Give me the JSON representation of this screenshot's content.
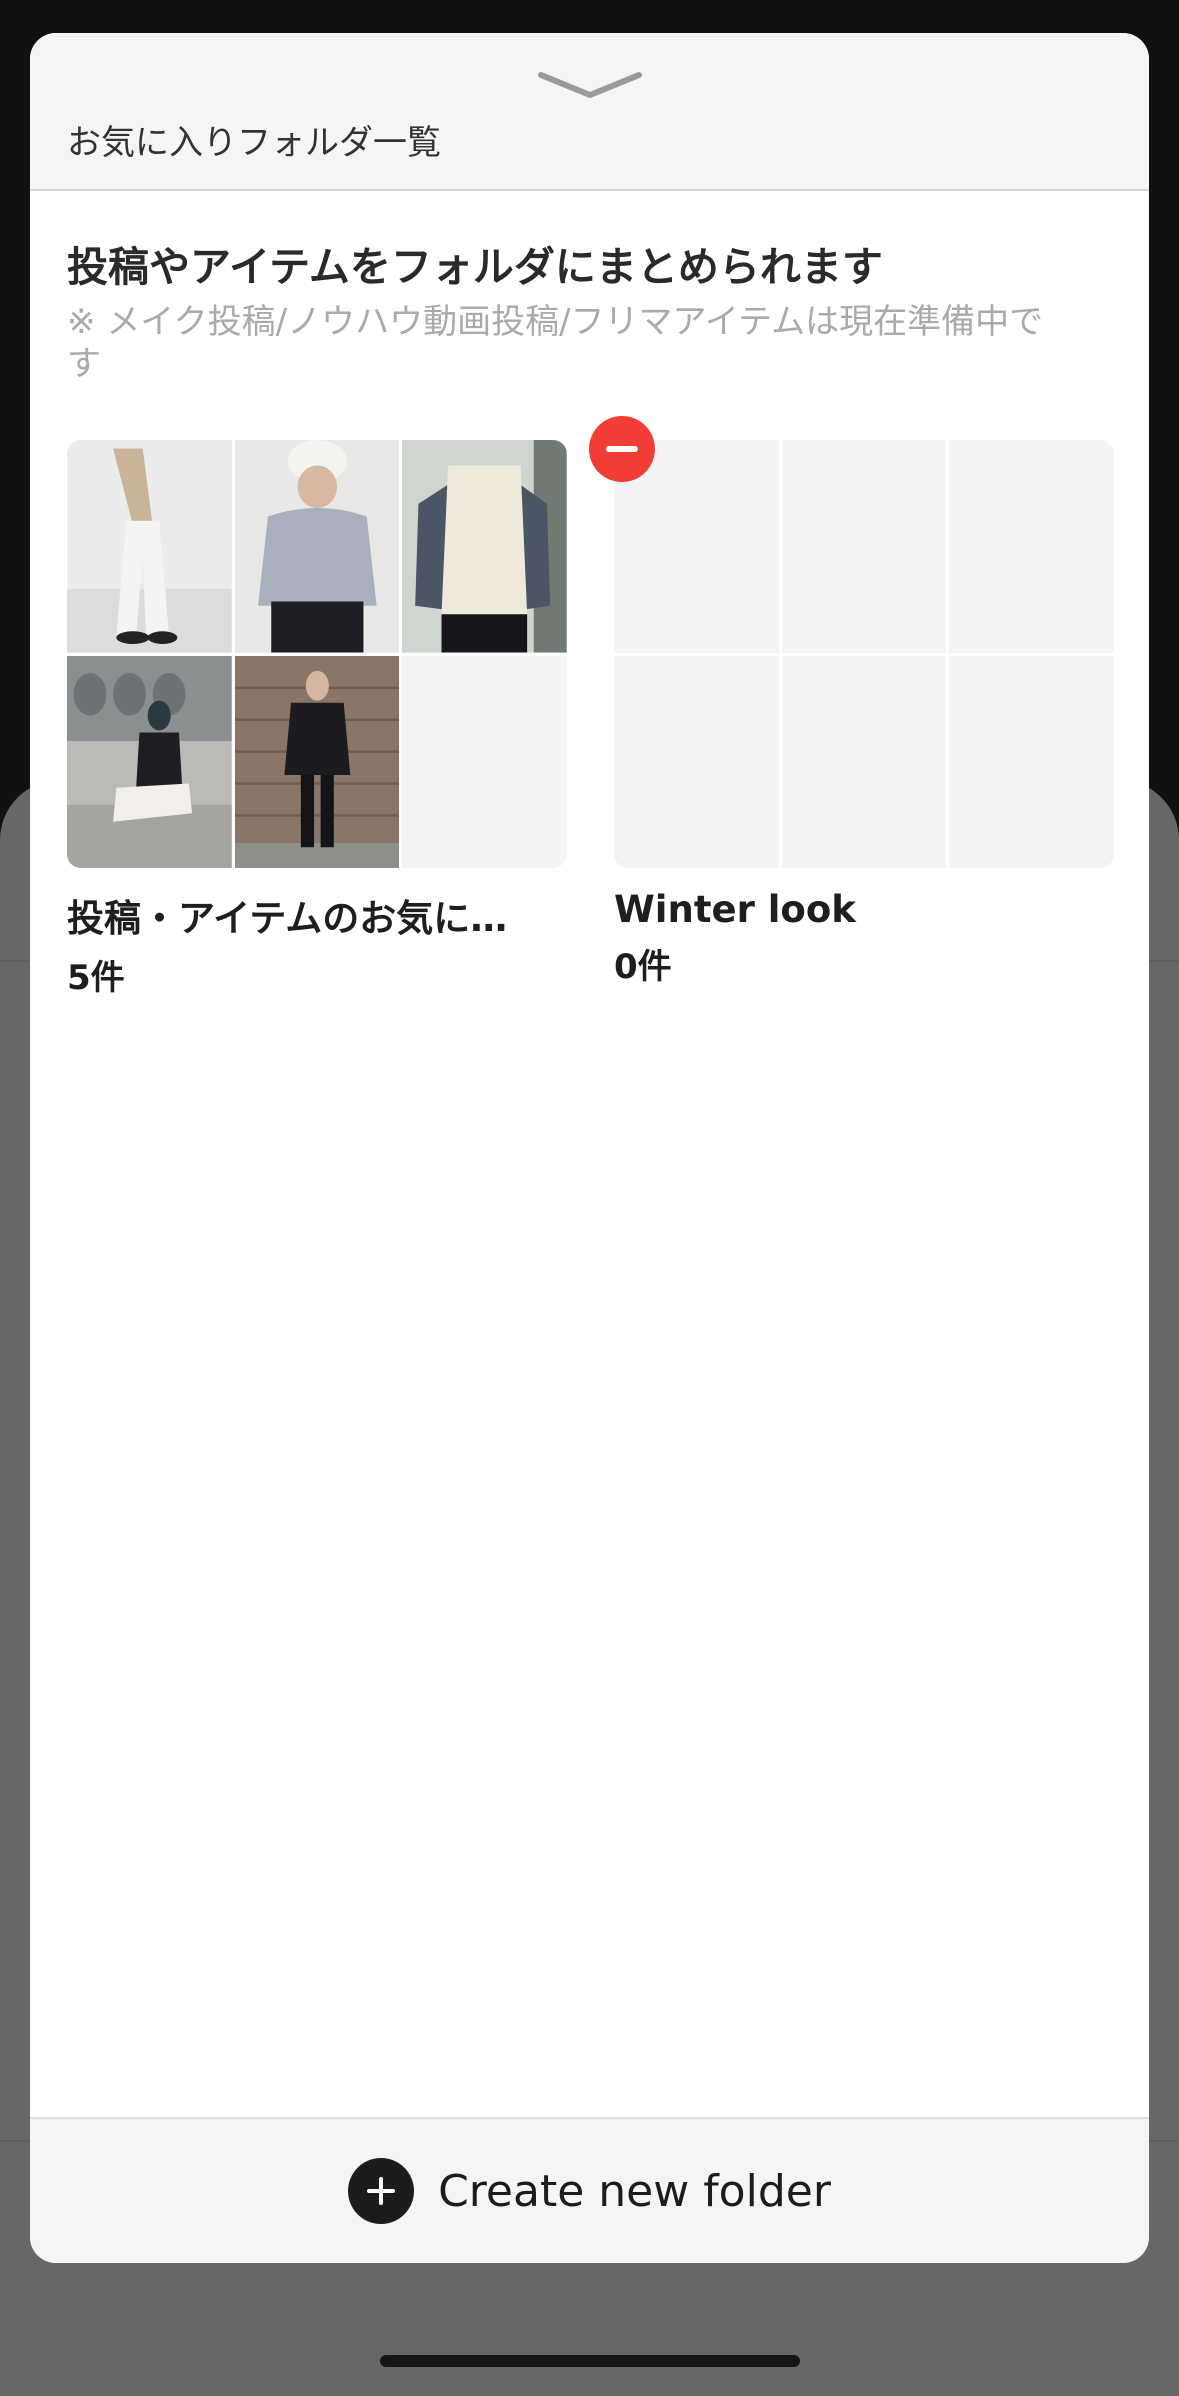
{
  "sheet": {
    "header_title": "お気に入りフォルダ一覧",
    "intro_title": "投稿やアイテムをフォルダにまとめられます",
    "intro_note": "※ メイク投稿/ノウハウ動画投稿/フリマアイテムは現在準備中です"
  },
  "folders": [
    {
      "name": "投稿・アイテムのお気に…",
      "count": "5件",
      "thumbnails": [
        "white-pants-outfit",
        "grey-sweater-beanie-outfit",
        "white-puffer-vest-outfit",
        "laundromat-outfit",
        "black-down-jacket-outfit"
      ]
    },
    {
      "name": "Winter look",
      "count": "0件",
      "thumbnails": []
    }
  ],
  "footer": {
    "create_label": "Create new folder"
  },
  "colors": {
    "delete_badge": "#f23c36",
    "empty_cell": "#f3f4f6"
  }
}
